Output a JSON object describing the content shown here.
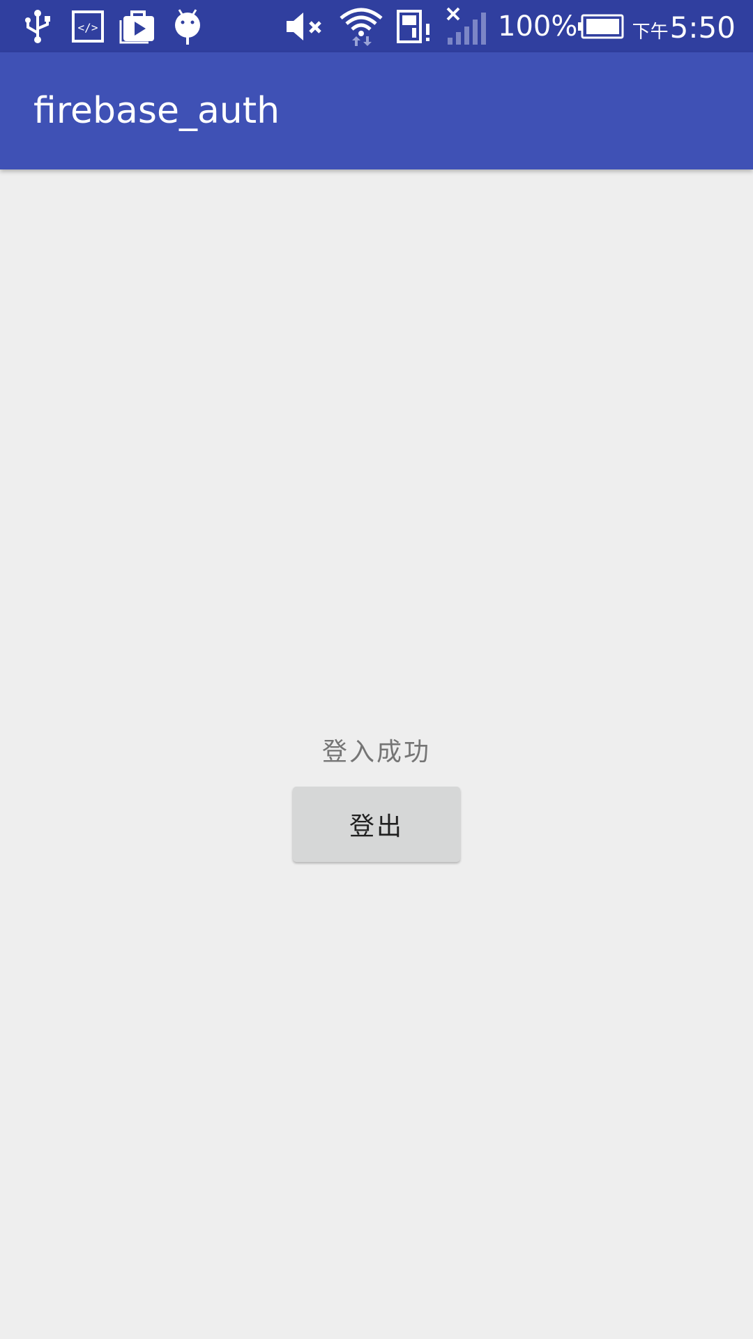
{
  "status_bar": {
    "battery_percent": "100%",
    "clock_ampm": "下午",
    "clock_time": "5:50",
    "icons": [
      "usb-icon",
      "code-icon",
      "play-store-icon",
      "android-debug-icon",
      "volume-mute-icon",
      "wifi-icon",
      "sd-card-alert-icon",
      "no-signal-icon",
      "battery-icon"
    ],
    "background_color": "#303f9f"
  },
  "app_bar": {
    "title": "firebase_auth",
    "background_color": "#3f51b5"
  },
  "main": {
    "status_text": "登入成功",
    "logout_label": "登出"
  }
}
